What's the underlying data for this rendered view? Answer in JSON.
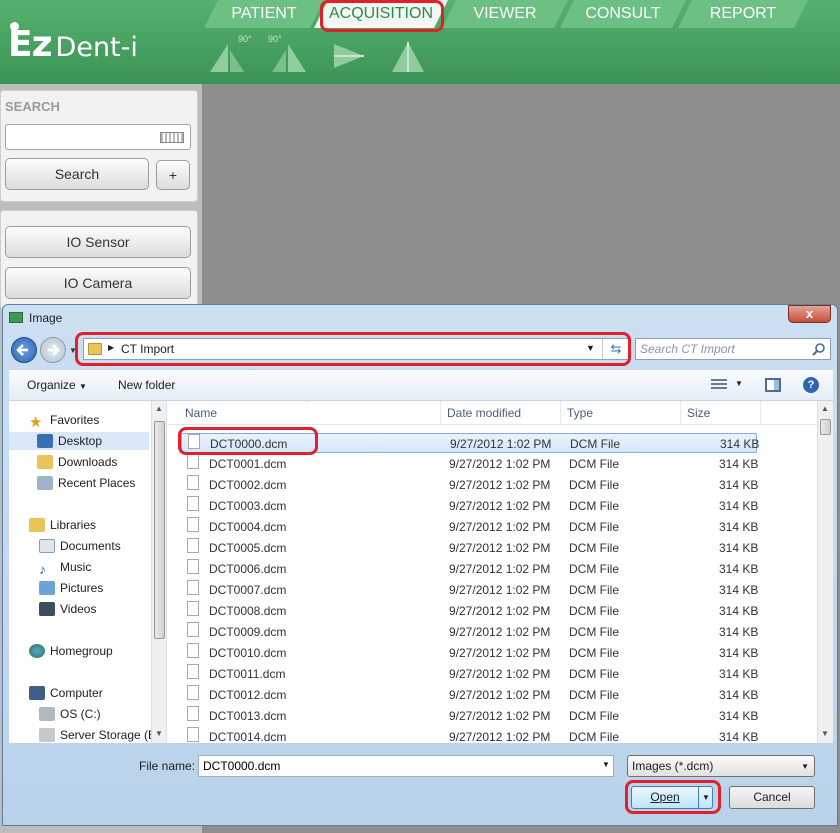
{
  "app": {
    "logo_text_1": "Ez",
    "logo_text_2": "Dent-i",
    "tabs": [
      "PATIENT",
      "ACQUISITION",
      "VIEWER",
      "CONSULT",
      "REPORT"
    ],
    "tool_badges": [
      "90°",
      "90°"
    ],
    "search": {
      "heading": "SEARCH",
      "button": "Search",
      "plus": "+"
    },
    "buttons": [
      "IO Sensor",
      "IO Camera"
    ],
    "colors": {
      "header_green": "#3b9455",
      "highlight_red": "#e0202a"
    }
  },
  "dialog": {
    "title": "Image",
    "close": "x",
    "address": "CT Import",
    "search_placeholder": "Search CT Import",
    "organize": "Organize",
    "new_folder": "New folder",
    "nav": {
      "favorites": "Favorites",
      "favorites_items": [
        "Desktop",
        "Downloads",
        "Recent Places"
      ],
      "libraries": "Libraries",
      "libraries_items": [
        "Documents",
        "Music",
        "Pictures",
        "Videos"
      ],
      "homegroup": "Homegroup",
      "computer": "Computer",
      "computer_items": [
        "OS (C:)",
        "Server Storage (E:"
      ]
    },
    "columns": [
      "Name",
      "Date modified",
      "Type",
      "Size"
    ],
    "files": [
      {
        "name": "DCT0000.dcm",
        "date": "9/27/2012 1:02 PM",
        "type": "DCM File",
        "size": "314 KB"
      },
      {
        "name": "DCT0001.dcm",
        "date": "9/27/2012 1:02 PM",
        "type": "DCM File",
        "size": "314 KB"
      },
      {
        "name": "DCT0002.dcm",
        "date": "9/27/2012 1:02 PM",
        "type": "DCM File",
        "size": "314 KB"
      },
      {
        "name": "DCT0003.dcm",
        "date": "9/27/2012 1:02 PM",
        "type": "DCM File",
        "size": "314 KB"
      },
      {
        "name": "DCT0004.dcm",
        "date": "9/27/2012 1:02 PM",
        "type": "DCM File",
        "size": "314 KB"
      },
      {
        "name": "DCT0005.dcm",
        "date": "9/27/2012 1:02 PM",
        "type": "DCM File",
        "size": "314 KB"
      },
      {
        "name": "DCT0006.dcm",
        "date": "9/27/2012 1:02 PM",
        "type": "DCM File",
        "size": "314 KB"
      },
      {
        "name": "DCT0007.dcm",
        "date": "9/27/2012 1:02 PM",
        "type": "DCM File",
        "size": "314 KB"
      },
      {
        "name": "DCT0008.dcm",
        "date": "9/27/2012 1:02 PM",
        "type": "DCM File",
        "size": "314 KB"
      },
      {
        "name": "DCT0009.dcm",
        "date": "9/27/2012 1:02 PM",
        "type": "DCM File",
        "size": "314 KB"
      },
      {
        "name": "DCT0010.dcm",
        "date": "9/27/2012 1:02 PM",
        "type": "DCM File",
        "size": "314 KB"
      },
      {
        "name": "DCT0011.dcm",
        "date": "9/27/2012 1:02 PM",
        "type": "DCM File",
        "size": "314 KB"
      },
      {
        "name": "DCT0012.dcm",
        "date": "9/27/2012 1:02 PM",
        "type": "DCM File",
        "size": "314 KB"
      },
      {
        "name": "DCT0013.dcm",
        "date": "9/27/2012 1:02 PM",
        "type": "DCM File",
        "size": "314 KB"
      },
      {
        "name": "DCT0014.dcm",
        "date": "9/27/2012 1:02 PM",
        "type": "DCM File",
        "size": "314 KB"
      }
    ],
    "filename_label": "File name:",
    "filename_value": "DCT0000.dcm",
    "filetype": "Images (*.dcm)",
    "open": "Open",
    "cancel": "Cancel"
  }
}
